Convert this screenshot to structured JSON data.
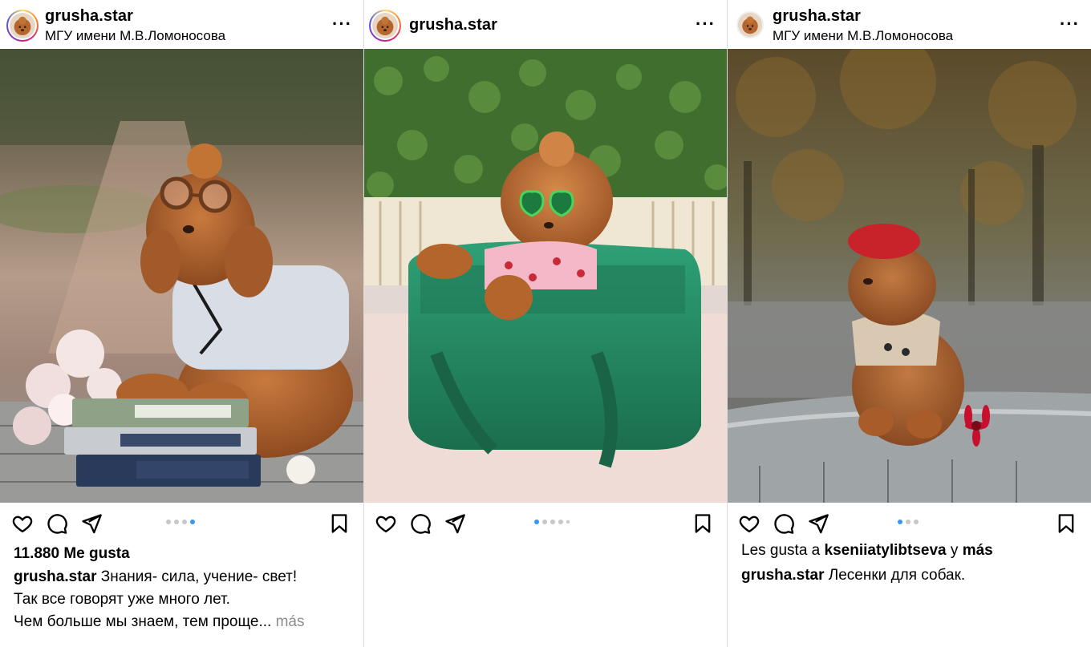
{
  "posts": [
    {
      "username": "grusha.star",
      "location": "МГУ имени М.В.Ломоносова",
      "more_icon": "more-icon",
      "photo_alt": "poodle with glasses and books",
      "dots_total": 4,
      "dots_active": 4,
      "likes": "11.880 Me gusta",
      "caption_user": "grusha.star",
      "caption_line1": "Знания- сила, учение- свет!",
      "caption_line2": "Так все говорят уже много лет.",
      "caption_line3": "Чем больше мы знаем, тем проще...",
      "more_label": "más"
    },
    {
      "username": "grusha.star",
      "location": "",
      "photo_alt": "poodle in green bag",
      "dots_total": 5,
      "dots_active": 1
    },
    {
      "username": "grusha.star",
      "location": "МГУ имени М.В.Ломоносова",
      "photo_alt": "poodle in red beret",
      "dots_total": 3,
      "dots_active": 1,
      "likes_prefix": "Les gusta a",
      "likes_user": "kseniiatylibtseva",
      "likes_mid": "y",
      "likes_more": "más",
      "caption_user": "grusha.star",
      "caption_text": "Лесенки для собак."
    }
  ],
  "icons": {
    "like": "heart-icon",
    "comment": "comment-icon",
    "share": "send-icon",
    "save": "bookmark-icon"
  },
  "colors": {
    "accent": "#3897f0",
    "muted": "#8e8e8e",
    "divider": "#dbdbdb"
  }
}
